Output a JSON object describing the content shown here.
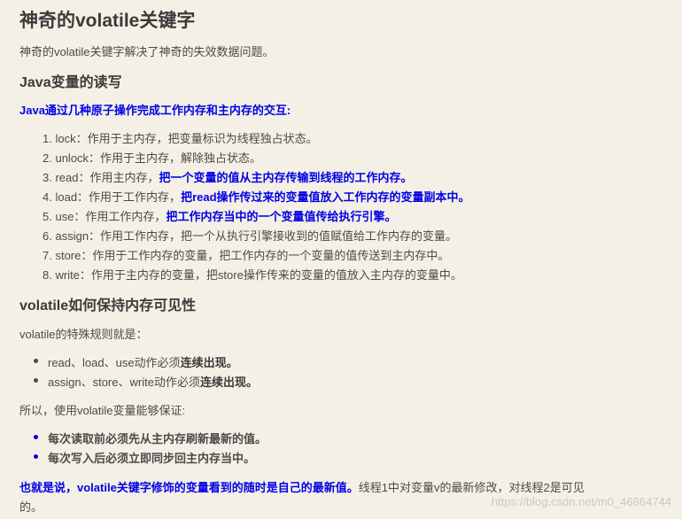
{
  "title": "神奇的volatile关键字",
  "intro": "神奇的volatile关键字解决了神奇的失效数据问题。",
  "section1": {
    "heading": "Java变量的读写",
    "lead": "Java通过几种原子操作完成工作内存和主内存的交互:",
    "items": [
      {
        "num": "1.",
        "text": "lock：作用于主内存，把变量标识为线程独占状态。",
        "emph": ""
      },
      {
        "num": "2.",
        "text": "unlock：作用于主内存，解除独占状态。",
        "emph": ""
      },
      {
        "num": "3.",
        "text": "read：作用主内存，",
        "emph": "把一个变量的值从主内存传输到线程的工作内存。"
      },
      {
        "num": "4.",
        "text": "load：作用于工作内存，",
        "emph": "把read操作传过来的变量值放入工作内存的变量副本中。"
      },
      {
        "num": "5.",
        "text": "use：作用工作内存，",
        "emph": "把工作内存当中的一个变量值传给执行引擎。"
      },
      {
        "num": "6.",
        "text": "assign：作用工作内存，把一个从执行引擎接收到的值赋值给工作内存的变量。",
        "emph": ""
      },
      {
        "num": "7.",
        "text": "store：作用于工作内存的变量，把工作内存的一个变量的值传送到主内存中。",
        "emph": ""
      },
      {
        "num": "8.",
        "text": "write：作用于主内存的变量，把store操作传来的变量的值放入主内存的变量中。",
        "emph": ""
      }
    ]
  },
  "section2": {
    "heading": "volatile如何保持内存可见性",
    "rules_intro": "volatile的特殊规则就是：",
    "rules": [
      {
        "text": "read、load、use动作必须",
        "strong": "连续出现。"
      },
      {
        "text": "assign、store、write动作必须",
        "strong": "连续出现。"
      }
    ],
    "guarantee_intro": "所以，使用volatile变量能够保证:",
    "guarantees": [
      "每次读取前必须先从主内存刷新最新的值。",
      "每次写入后必须立即同步回主内存当中。"
    ],
    "conclusion_emph": "也就是说，volatile关键字修饰的变量看到的随时是自己的最新值。",
    "conclusion_rest": "线程1中对变量v的最新修改，对线程2是可见",
    "conclusion_tail": "的。"
  },
  "watermark": "https://blog.csdn.net/m0_46864744"
}
